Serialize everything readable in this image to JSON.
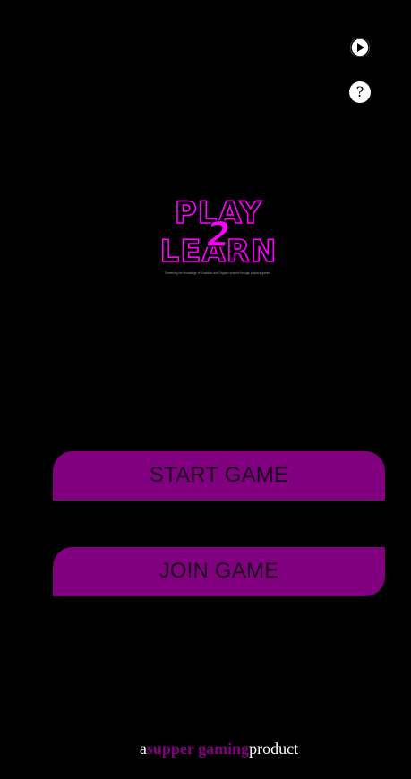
{
  "top_controls": {
    "play_icon": "play-icon",
    "help_icon": "help-icon",
    "help_glyph": "?"
  },
  "logo": {
    "line1": "PLAY",
    "middle": "2",
    "line2": "LEARN",
    "tagline": "Screening the knowledge of Evolution and Organic science through physical games",
    "outline_color": "#ff00ff",
    "accent_color": "#ff00ff"
  },
  "menu": {
    "start_label": "START GAME",
    "join_label": "JOIN GAME",
    "button_color": "#800080"
  },
  "footer": {
    "prefix": "a",
    "brand": "supper gaming",
    "suffix": "product",
    "brand_color": "#800080"
  }
}
